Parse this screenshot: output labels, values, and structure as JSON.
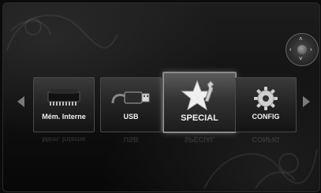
{
  "menu": {
    "items": [
      {
        "label": "Mém. Interne",
        "icon": "memory-chip-icon"
      },
      {
        "label": "USB",
        "icon": "usb-drive-icon"
      },
      {
        "label": "SPECIAL",
        "icon": "star-wrench-icon",
        "selected": true
      },
      {
        "label": "CONFIG",
        "icon": "gear-icon"
      }
    ]
  },
  "navigation": {
    "left_arrow": "left-arrow-icon",
    "right_arrow": "right-arrow-icon",
    "remote_hint": "dpad-icon"
  },
  "colors": {
    "background": "#101010",
    "tile": "#2a2a2a",
    "selected_border": "#8a8a8a",
    "text": "#f2f2f2"
  }
}
